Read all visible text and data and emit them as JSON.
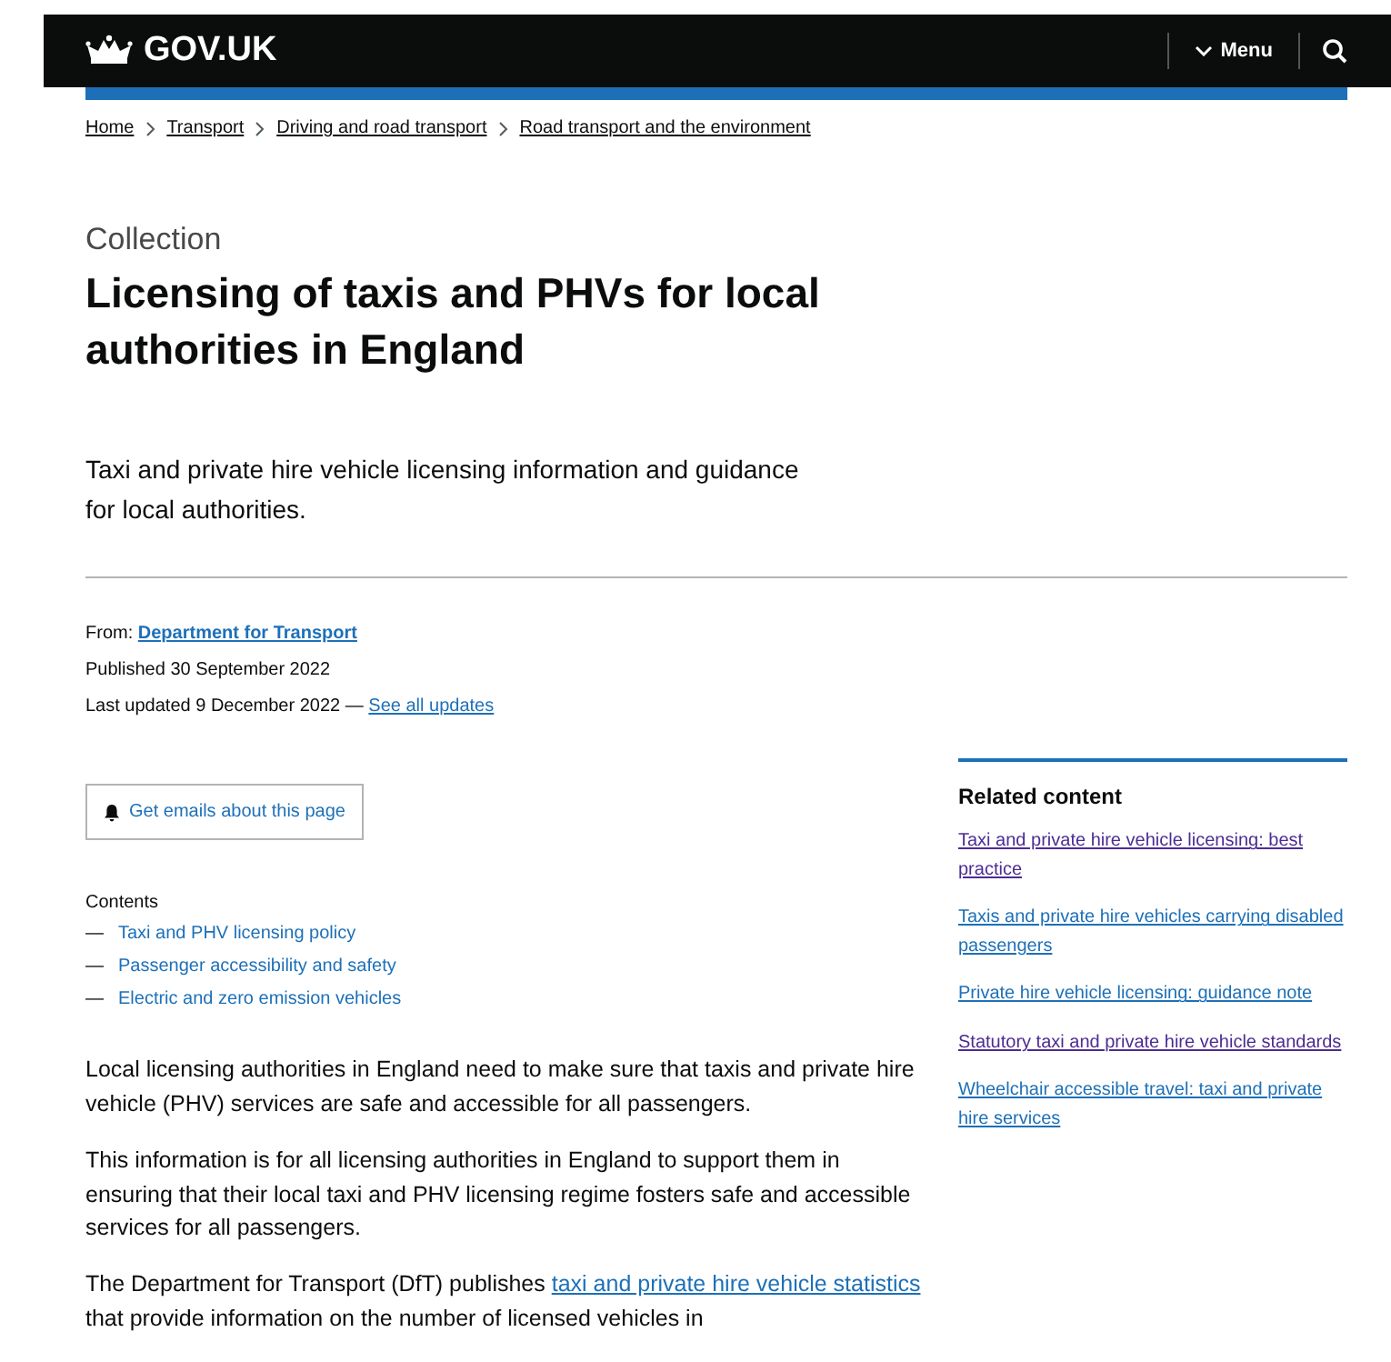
{
  "header": {
    "logo": "GOV.UK",
    "menu": "Menu"
  },
  "breadcrumbs": [
    "Home",
    "Transport",
    "Driving and road transport",
    "Road transport and the environment"
  ],
  "caption": "Collection",
  "title": "Licensing of taxis and PHVs for local authorities in England",
  "lead": "Taxi and private hire vehicle licensing information and guidance for local authorities.",
  "meta": {
    "from_label": "From:",
    "from_link": "Department for Transport",
    "published_label": "Published",
    "published": "30 September 2022",
    "updated_label": "Last updated",
    "updated": "9 December 2022 —",
    "updates_link": "See all updates"
  },
  "email_button": "Get emails about this page",
  "contents": {
    "heading": "Contents",
    "items": [
      {
        "dash": "—",
        "label": "Taxi and PHV licensing policy"
      },
      {
        "dash": "—",
        "label": "Passenger accessibility and safety"
      },
      {
        "dash": "—",
        "label": "Electric and zero emission vehicles"
      }
    ]
  },
  "body": [
    {
      "kind": "text",
      "text": "Local licensing authorities in England need to make sure that taxis and private hire vehicle (PHV) services are safe and accessible for all passengers."
    },
    {
      "kind": "text",
      "text": "This information is for all licensing authorities in England to support them in ensuring that their local taxi and PHV licensing regime fosters safe and accessible services for all passengers."
    },
    {
      "kind": "linked",
      "before": "The Department for Transport (DfT) publishes ",
      "link": "taxi and private hire vehicle statistics",
      "after": " that provide information on the number of licensed vehicles in"
    }
  ],
  "related": {
    "heading": "Related content",
    "links": [
      {
        "label": "Taxi and private hire vehicle licensing: best practice",
        "visited": true
      },
      {
        "label": "Taxis and private hire vehicles carrying disabled passengers",
        "visited": false
      },
      {
        "label": "Private hire vehicle licensing: guidance note",
        "visited": false
      },
      {
        "label": "Statutory taxi and private hire vehicle standards",
        "visited": true
      },
      {
        "label": "Wheelchair accessible travel: taxi and private hire services",
        "visited": false
      }
    ]
  }
}
